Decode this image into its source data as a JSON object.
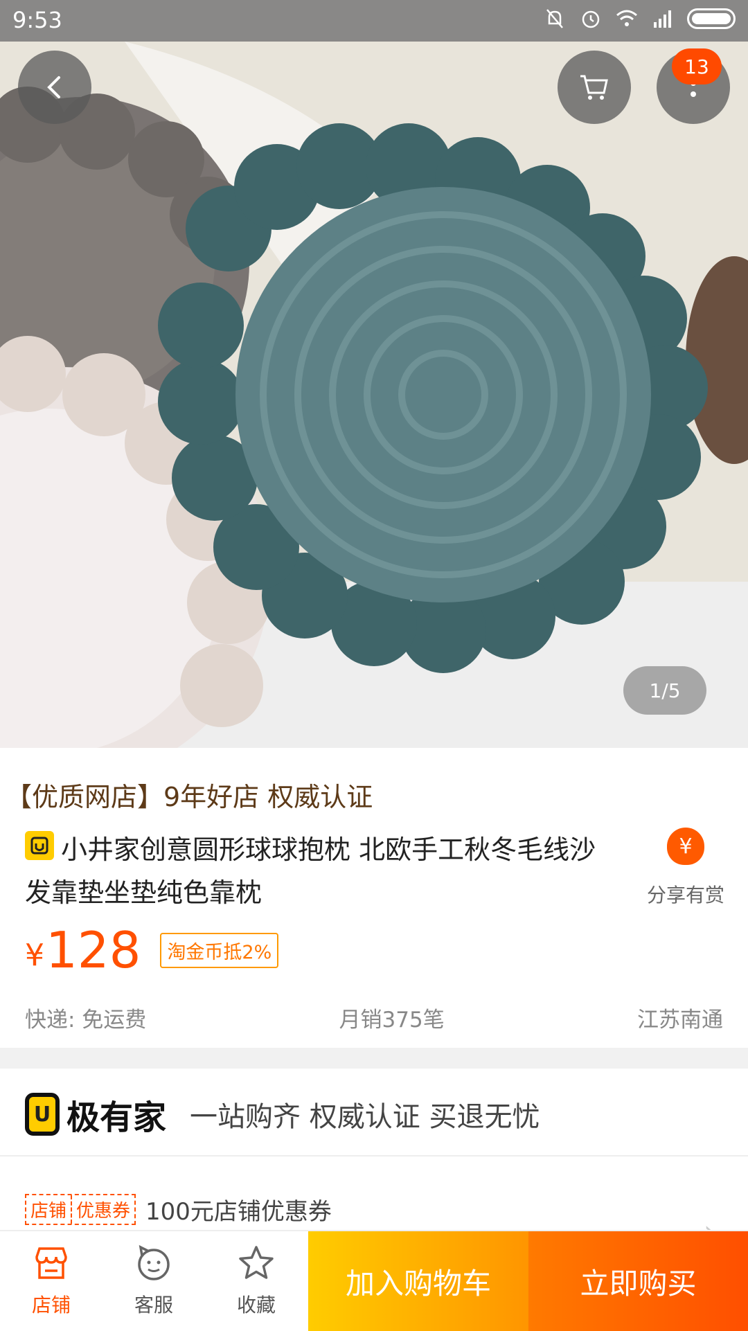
{
  "status_bar": {
    "time": "9:53",
    "icons": [
      "mute-bell-icon",
      "alarm-icon",
      "wifi-icon",
      "signal-icon",
      "battery-icon"
    ]
  },
  "header": {
    "cart_badge": "13",
    "icons": {
      "back": "back-chevron-icon",
      "cart": "cart-icon",
      "more": "more-icon"
    }
  },
  "gallery": {
    "indicator": "1/5"
  },
  "product": {
    "shop_tagline": "【优质网店】9年好店 权威认证",
    "title": "小井家创意圆形球球抱枕 北欧手工秋冬毛线沙发靠垫坐垫纯色靠枕",
    "price_symbol": "¥",
    "price": "128",
    "coin_tag": "淘金币抵2%",
    "share_label": "分享有赏",
    "shipping": "快递: 免运费",
    "monthly_sales": "月销375笔",
    "location": "江苏南通"
  },
  "brand": {
    "logo_letter": "U",
    "name": "极有家",
    "slogan": "一站购齐 权威认证 买退无忧"
  },
  "coupon": {
    "tag_left": "店铺",
    "tag_right": "优惠券",
    "text": "100元店铺优惠券"
  },
  "bottom_bar": {
    "shop": "店铺",
    "service": "客服",
    "favorite": "收藏",
    "add_to_cart": "加入购物车",
    "buy_now": "立即购买"
  },
  "colors": {
    "accent": "#ff5000",
    "cart_button": "#ffaa00",
    "buy_button": "#ff5a00",
    "brand_yellow": "#ffcc00"
  }
}
